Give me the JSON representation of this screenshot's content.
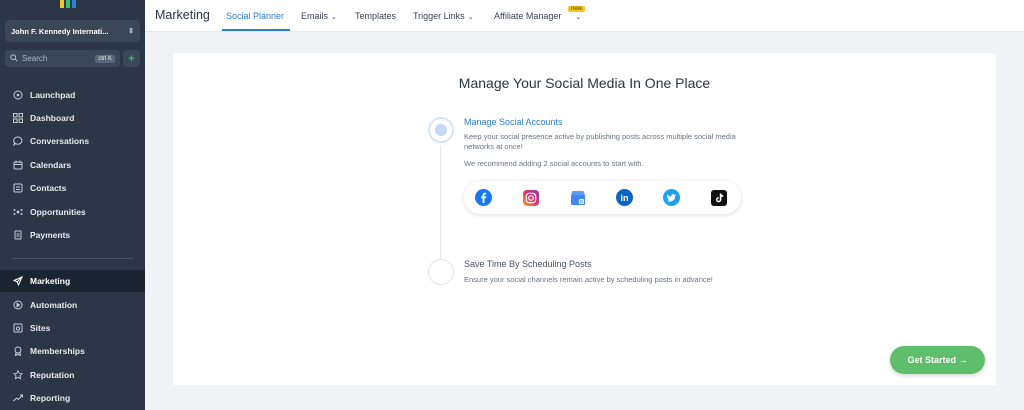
{
  "sidebar": {
    "account_name": "John F. Kennedy Internati...",
    "search_placeholder": "Search",
    "search_shortcut": "ctrl K",
    "add_label": "+",
    "items": [
      {
        "label": "Launchpad",
        "icon": "rocket-icon"
      },
      {
        "label": "Dashboard",
        "icon": "grid-icon"
      },
      {
        "label": "Conversations",
        "icon": "chat-icon"
      },
      {
        "label": "Calendars",
        "icon": "calendar-icon"
      },
      {
        "label": "Contacts",
        "icon": "contacts-icon"
      },
      {
        "label": "Opportunities",
        "icon": "opportunities-icon"
      },
      {
        "label": "Payments",
        "icon": "payments-icon"
      },
      {
        "label": "Marketing",
        "icon": "send-icon"
      },
      {
        "label": "Automation",
        "icon": "automation-icon"
      },
      {
        "label": "Sites",
        "icon": "sites-icon"
      },
      {
        "label": "Memberships",
        "icon": "membership-icon"
      },
      {
        "label": "Reputation",
        "icon": "star-icon"
      },
      {
        "label": "Reporting",
        "icon": "reporting-icon"
      }
    ]
  },
  "topbar": {
    "title": "Marketing",
    "tabs": [
      {
        "label": "Social Planner"
      },
      {
        "label": "Emails"
      },
      {
        "label": "Templates"
      },
      {
        "label": "Trigger Links"
      },
      {
        "label": "Affiliate Manager"
      }
    ],
    "new_badge": "new"
  },
  "main": {
    "heading": "Manage Your Social Media In One Place",
    "step1": {
      "title": "Manage Social Accounts",
      "text": "Keep your social presence active by publishing posts across multiple social media networks at once!",
      "hint": "We recommend adding 2 social accounts to start with."
    },
    "step2": {
      "title": "Save Time By Scheduling Posts",
      "text": "Ensure your social channels remain active by scheduling posts in advance!"
    },
    "socials": [
      "facebook-icon",
      "instagram-icon",
      "google-business-icon",
      "linkedin-icon",
      "twitter-icon",
      "tiktok-icon"
    ],
    "cta": "Get Started →"
  },
  "colors": {
    "sidebar_bg": "#2c3646",
    "accent": "#2b7fd1",
    "cta": "#5fbe6c"
  }
}
